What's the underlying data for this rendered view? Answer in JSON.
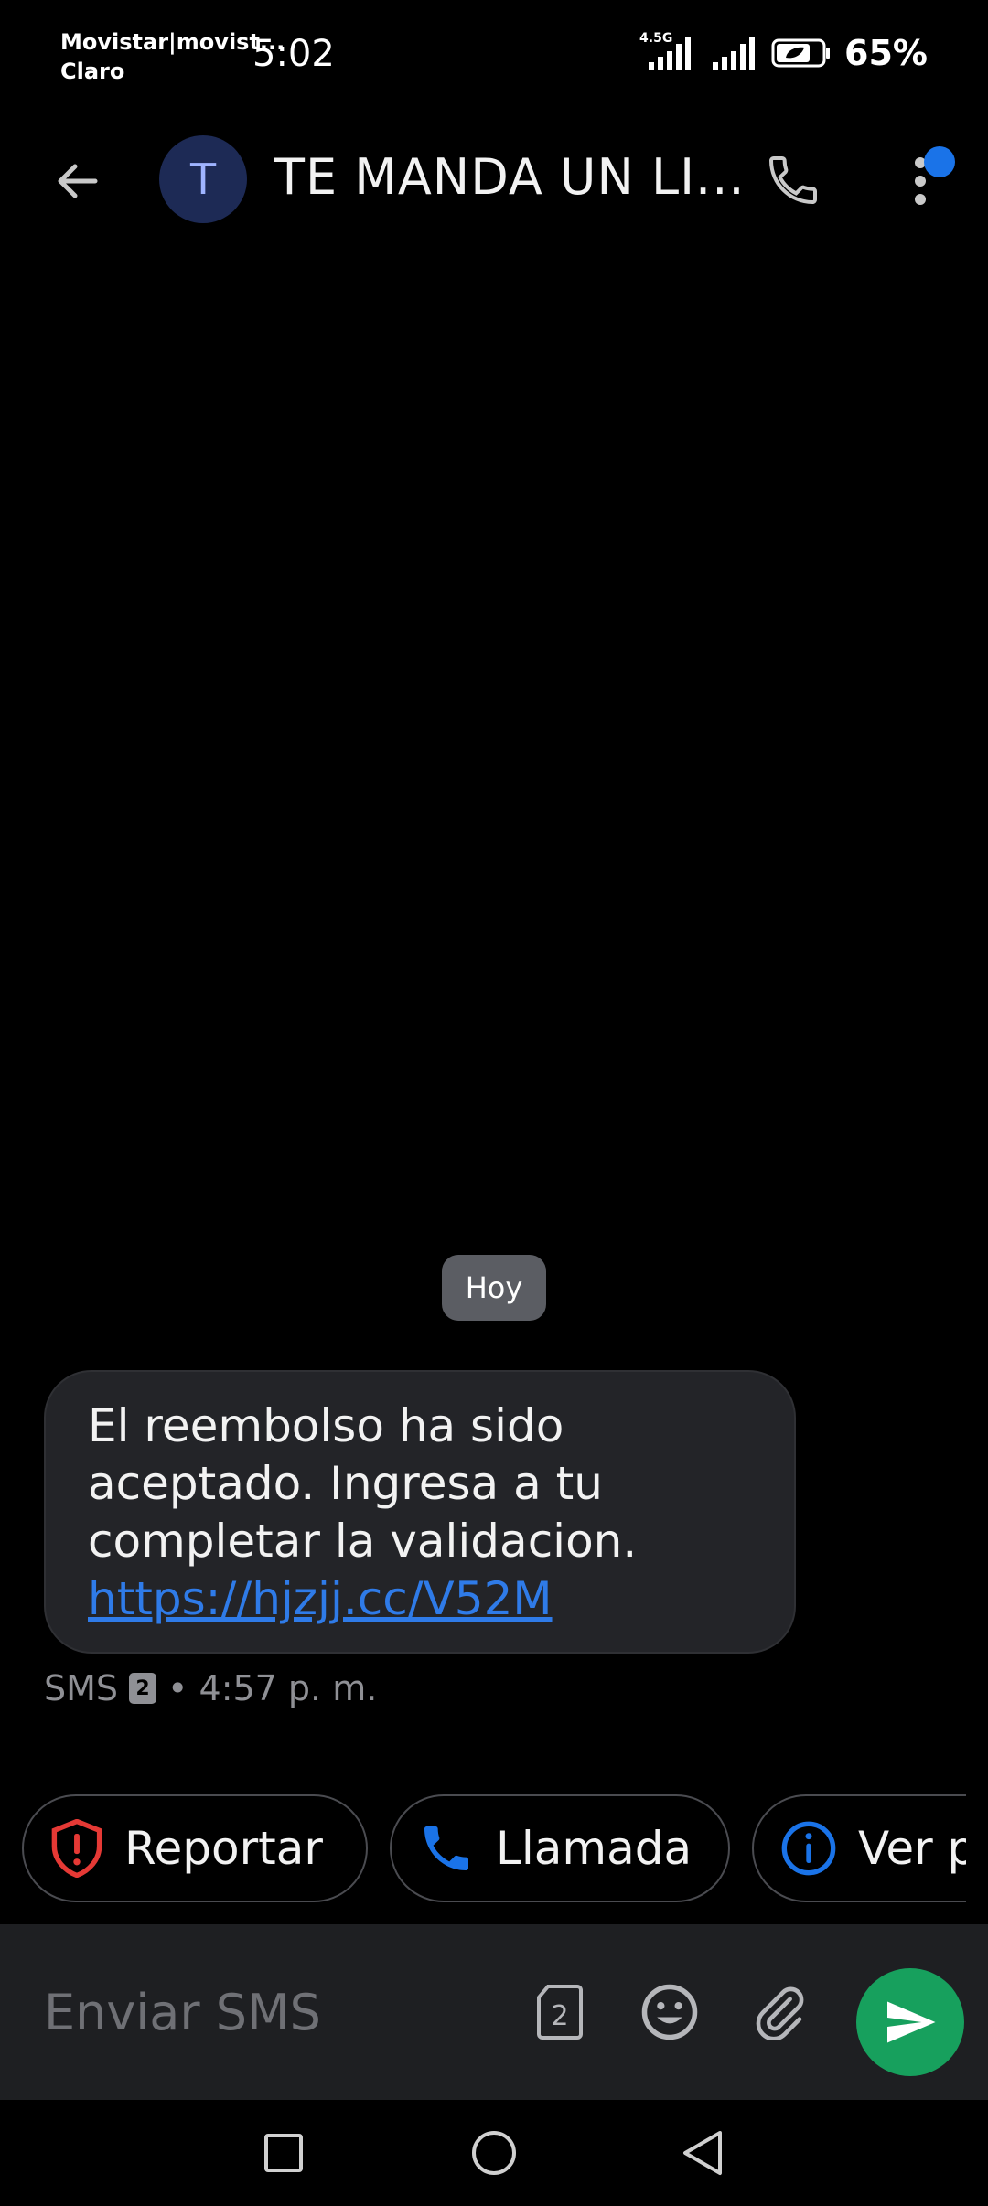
{
  "status_bar": {
    "carrier_line1": "Movistar|movist...",
    "carrier_line2": "Claro",
    "time": "5:02",
    "network_label": "4.5G",
    "battery_percent": "65%"
  },
  "app_bar": {
    "avatar_letter": "T",
    "contact_name": "TE MANDA UN LI...",
    "icons": [
      "back-arrow-icon",
      "phone-icon",
      "more-vert-icon"
    ]
  },
  "conversation": {
    "date_chip": "Hoy",
    "messages": [
      {
        "text": "El reembolso ha sido aceptado. Ingresa a tu completar la validacion.",
        "link": "https://hjzjj.cc/V52M",
        "meta_type": "SMS",
        "sim_slot": "2",
        "time": "• 4:57 p. m."
      }
    ]
  },
  "suggestions": [
    {
      "label": "Reportar",
      "icon": "shield-alert-icon",
      "color": "#e53935"
    },
    {
      "label": "Llamada",
      "icon": "phone-icon",
      "color": "#1a73e8"
    },
    {
      "label": "Ver p",
      "icon": "info-icon",
      "color": "#1a73e8"
    }
  ],
  "composer": {
    "placeholder": "Enviar SMS",
    "sim_slot": "2",
    "send_color": "#17a05d"
  },
  "colors": {
    "accent_blue": "#1a73e8",
    "bubble_bg": "#232428",
    "link": "#2f7be8"
  }
}
